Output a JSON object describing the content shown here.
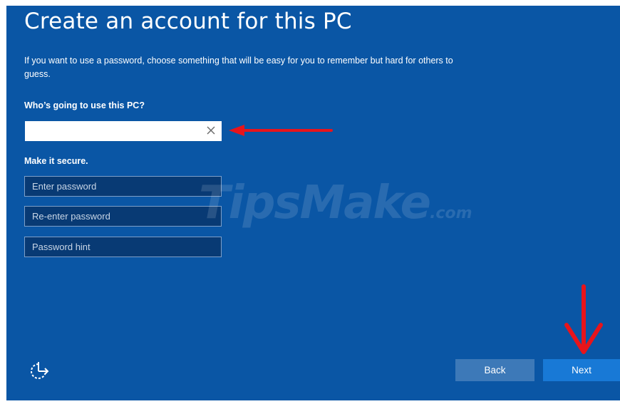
{
  "page": {
    "title": "Create an account for this PC",
    "description": "If you want to use a password, choose something that will be easy for you to remember but hard for others to guess."
  },
  "user_section": {
    "label": "Who’s going to use this PC?",
    "value": "",
    "clear_icon": "close-icon"
  },
  "secure_section": {
    "label": "Make it secure.",
    "password_placeholder": "Enter password",
    "reenter_placeholder": "Re-enter password",
    "hint_placeholder": "Password hint"
  },
  "footer": {
    "ease_of_access_icon": "ease-of-access-icon",
    "back_label": "Back",
    "next_label": "Next"
  },
  "watermark": {
    "main": "TipsMake",
    "suffix": ".com"
  },
  "colors": {
    "background": "#0a56a5",
    "annotation_red": "#e8141b",
    "back_button": "#3d79b8",
    "next_button": "#1879d6"
  }
}
